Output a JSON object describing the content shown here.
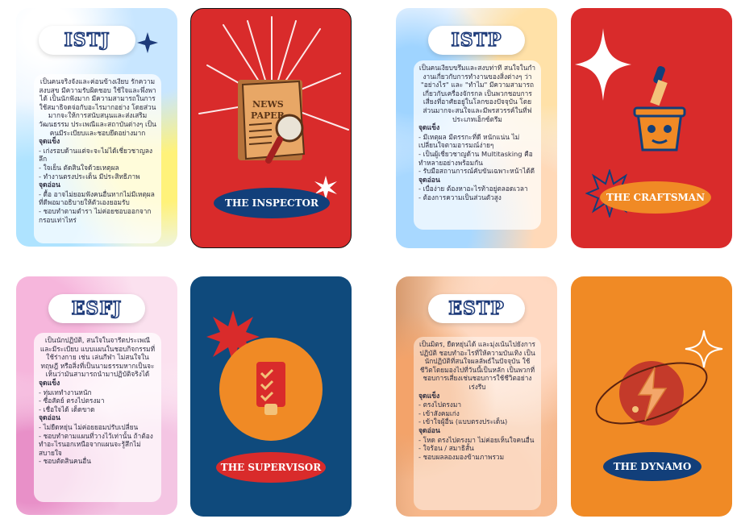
{
  "cards": {
    "istj": {
      "title": "ISTJ",
      "desc": "เป็นคนจริงจังและค่อนข้างเงียบ รักความสงบสุข มีความรับผิดชอบ ใช้ใจและพึ่งพาได้ เป็นนักฟังมาก มีความสามารถในการใช้สมาธิจดจ่อกับอะไรมากอย่าง โดยส่วนมากจะให้การสนับสนุนและส่งเสริมวัฒนธรรม ประเพณีและสถาบันต่างๆ เป็นคนมีระเบียบและชอบยึดอย่างมาก",
      "strengths_label": "จุดแข็ง",
      "strengths": [
        "- เก่งรอบด้านแต่จะจะไม่ได้เชี่ยวชาญลงลึก",
        "- ใจเย็น ตัดสินใจด้วยเหตุผล",
        "- ทำงานตรงประเด็น มีประสิทธิภาพ"
      ],
      "weaknesses_label": "จุดอ่อน",
      "weaknesses": [
        "- ดื้อ อาจไม่ยอมฟังคนอื่นหากไม่มีเหตุผลที่ดีพอมาอธิบายให้ตัวเองยอมรับ",
        "- ชอบทำตามตำรา ไม่ค่อยชอบออกจากกรอบเท่าไหร่"
      ]
    },
    "istp": {
      "title": "ISTP",
      "desc": "เป็นคนเงียบขรึมและสงบท่าที สนใจในกำงานเกี่ยวกับการทำงานของสิ่งต่างๆ ว่า \"อย่างไร\" และ \"ทำไม\" มีความสามารถเกี่ยวกับเครื่องจักรกล เป็นพวกชอบการเสี่ยงที่อาศัยอยู่ในโลกของปัจจุบัน โดยส่วนมากจะสนใจและมีพรสวรรค์ในที่ฟประเภทเอ็กซ์ตรีม",
      "strengths_label": "จุดแข็ง",
      "strengths": [
        "- มีเหตุผล มีตรรกะที่ดี หนักแน่น ไม่เปลี่ยนใจตามอารมณ์ง่ายๆ",
        "- เป็นผู้เชี่ยวชาญด้าน Multitasking คือทำหลายอย่างพร้อมกัน",
        "- รับมือสถานการณ์คับขันเฉพาะหน้าได้ดี"
      ],
      "weaknesses_label": "จุดอ่อน",
      "weaknesses": [
        "- เบื่อง่าย ต้องหาอะไรท้าอยู่ตลอดเวลา",
        "- ต้องการความเป็นส่วนตัวสูง"
      ]
    },
    "esfj": {
      "title": "ESFJ",
      "desc": "เป็นนักปฏิบัติ, สนใจในจารีตประเพณี และมีระเบียบ แบบแผนในชอบกิจกรรมที่ใช้ร่างกาย เช่น เล่นกีฬา ไม่สนใจในทฤษฎี หรือสิ่งที่เป็นนามธรรมหากเป็นจะเห็นว่ามันสามารถนำมาปฏิบัติจริงได้",
      "strengths_label": "จุดแข็ง",
      "strengths": [
        "- ทุ่มเททำงานหนัก",
        "- ซื่อสัตย์ ตรงไปตรงมา",
        "- เชื่อใจได้ เด็ดขาด"
      ],
      "weaknesses_label": "จุดอ่อน",
      "weaknesses": [
        "- ไม่ยืดหยุ่น ไม่ค่อยยอมปรับเปลี่ยน",
        "- ชอบทำตามแผนที่วางไว้เท่านั้น ถ้าต้องทำอะไรนอกเหนือจากแผนจะรู้สึกไม่สบายใจ",
        "- ชอบตัดสินคนอื่น"
      ]
    },
    "estp": {
      "title": "ESTP",
      "desc": "เป็นมิตร, ยืดหยุ่นได้ และมุ่งเน้นไปยังการปฏิบัติ ชอบทำอะไรที่ให้ความบันเทิง เป็นนักปฏิบัติที่สนใจผลลัพธ์ในปัจจุบัน ใช้ชีวิตโดยมองไปที่วันนี้เป็นหลัก เป็นพวกที่ชอบการเสี่ยงเช่นชอบการใช้ชีวิตอย่างเร่งรีบ",
      "strengths_label": "จุดแข็ง",
      "strengths": [
        "- ตรงไปตรงมา",
        "- เข้าสังคมเก่ง",
        "- เข้าใจผู้อื่น (แบบตรงประเด็น)"
      ],
      "weaknesses_label": "จุดอ่อน",
      "weaknesses": [
        "- โหด ตรงไปตรงมา ไม่ค่อยเห็นใจคนอื่น",
        "- ใจร้อน / สมาธิสั้น",
        "- ชอบผลลองมองข้ามภาพรวม"
      ]
    }
  },
  "characters": {
    "inspector": {
      "name": "THE INSPECTOR",
      "newspaper_text": "NEWS PAPER",
      "icon": "newspaper-magnifier-icon",
      "bg": "#d92b2b"
    },
    "craftsman": {
      "name": "THE CRAFTSMAN",
      "icon": "paintbrush-bucket-icon",
      "bg": "#d92b2b"
    },
    "supervisor": {
      "name": "THE SUPERVISOR",
      "icon": "checklist-icon",
      "bg": "#0f4a7c"
    },
    "dynamo": {
      "name": "THE DYNAMO",
      "icon": "lightning-planet-icon",
      "bg": "#f08a25"
    }
  },
  "colors": {
    "navy": "#123f7a",
    "red": "#d92b2b",
    "orange": "#f08a25",
    "blue": "#0f4a7c"
  }
}
